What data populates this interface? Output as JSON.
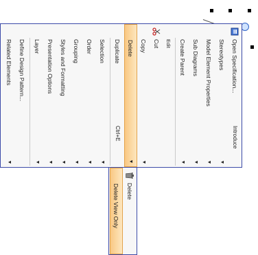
{
  "menu": {
    "items": [
      {
        "label": "Open Specification...",
        "shortcut": "Introduce",
        "arrow": "",
        "icon": "open-spec-icon"
      },
      {
        "label": "Stereotypes",
        "shortcut": "",
        "arrow": "▼",
        "icon": ""
      },
      {
        "label": "Model Element Properties",
        "shortcut": "",
        "arrow": "▼",
        "icon": ""
      },
      {
        "label": "Sub Diagrams",
        "shortcut": "",
        "arrow": "▼",
        "icon": ""
      },
      {
        "label": "Create Parent",
        "shortcut": "",
        "arrow": "▼",
        "icon": ""
      },
      {
        "label": "Edit",
        "shortcut": "",
        "arrow": "",
        "icon": ""
      },
      {
        "label": "Cut",
        "shortcut": "",
        "arrow": "",
        "icon": "scissors-icon"
      },
      {
        "label": "Copy",
        "shortcut": "",
        "arrow": "▼",
        "icon": ""
      },
      {
        "label": "Delete",
        "shortcut": "",
        "arrow": "▼",
        "icon": ""
      },
      {
        "label": "Duplicate",
        "shortcut": "Ctrl+E",
        "arrow": "",
        "icon": ""
      },
      {
        "label": "Selection",
        "shortcut": "",
        "arrow": "▼",
        "icon": ""
      },
      {
        "label": "Order",
        "shortcut": "",
        "arrow": "▼",
        "icon": ""
      },
      {
        "label": "Grouping",
        "shortcut": "",
        "arrow": "▼",
        "icon": ""
      },
      {
        "label": "Styles and Formatting",
        "shortcut": "",
        "arrow": "▼",
        "icon": ""
      },
      {
        "label": "Presentation Options",
        "shortcut": "",
        "arrow": "▼",
        "icon": ""
      },
      {
        "label": "Layer",
        "shortcut": "",
        "arrow": "▼",
        "icon": ""
      },
      {
        "label": "Define Design Pattern...",
        "shortcut": "",
        "arrow": "",
        "icon": ""
      },
      {
        "label": "Related Elements",
        "shortcut": "",
        "arrow": "▼",
        "icon": ""
      }
    ]
  },
  "submenu": {
    "items": [
      {
        "label": "Delete",
        "icon": "trash-icon"
      },
      {
        "label": "Delete View Only",
        "icon": ""
      }
    ]
  }
}
